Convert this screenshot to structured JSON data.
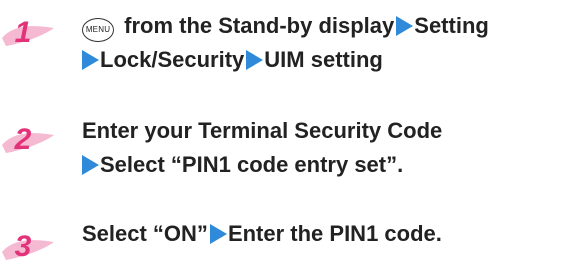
{
  "steps": [
    {
      "number": "1",
      "key_label": "MENU",
      "line1": [
        " from the Stand-by display",
        "Setting"
      ],
      "line2": [
        "Lock/Security",
        "UIM setting"
      ]
    },
    {
      "number": "2",
      "line1": "Enter your Terminal Security Code",
      "line2": "Select “PIN1 code entry set”."
    },
    {
      "number": "3",
      "line1": [
        "Select “ON”",
        "Enter the PIN1 code."
      ]
    }
  ],
  "colors": {
    "step_number": "#e2327a",
    "brush": "#f6b9d2",
    "arrow": "#2f8ad9",
    "text": "#222222"
  },
  "icons": {
    "arrow": "blue-triangle-arrow-icon",
    "menu_key": "menu-key-icon",
    "brush": "pink-brush-stroke-icon"
  }
}
